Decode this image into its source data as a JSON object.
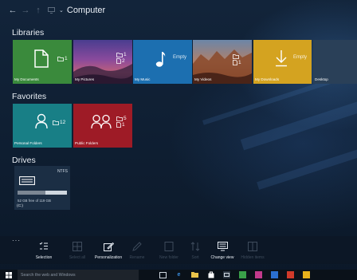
{
  "window": {
    "title": "Computer",
    "nav": {
      "back": "←",
      "forward": "→",
      "up": "↑"
    }
  },
  "sections": {
    "libraries": "Libraries",
    "favorites": "Favorites",
    "drives": "Drives"
  },
  "libraries": [
    {
      "name": "My Documents",
      "color": "#3a8a3c",
      "count": "1",
      "empty": ""
    },
    {
      "name": "My Pictures",
      "color": "#7a4aa0",
      "count": "2",
      "empty": ""
    },
    {
      "name": "My Music",
      "color": "#1c6fb0",
      "count": "",
      "empty": "Empty"
    },
    {
      "name": "My Videos",
      "color": "#a05a3a",
      "count": "1",
      "empty": ""
    },
    {
      "name": "My Downloads",
      "color": "#d4a320",
      "count": "",
      "empty": "Empty"
    },
    {
      "name": "Desktop",
      "color": "#2a4058",
      "count": "",
      "empty": ""
    }
  ],
  "favorites": [
    {
      "name": "Personal Folders",
      "color": "#187f86",
      "count": "12"
    },
    {
      "name": "Public Folders",
      "color": "#9e1b26",
      "count": "5"
    }
  ],
  "drive": {
    "filesystem": "NTFS",
    "free_text": "52 GB free of 119 GB",
    "used_fraction": 0.56,
    "letter": "(C:)"
  },
  "commands": {
    "more": "···",
    "items": [
      {
        "label": "Selection",
        "enabled": true,
        "icon": "selection-icon"
      },
      {
        "label": "Select all",
        "enabled": false,
        "icon": "select-all-icon"
      },
      {
        "label": "Personalization",
        "enabled": true,
        "icon": "personalization-icon"
      },
      {
        "label": "Rename",
        "enabled": false,
        "icon": "rename-icon"
      },
      {
        "label": "New folder",
        "enabled": false,
        "icon": "new-folder-icon"
      },
      {
        "label": "Sort",
        "enabled": false,
        "icon": "sort-icon"
      },
      {
        "label": "Change view",
        "enabled": true,
        "icon": "change-view-icon"
      },
      {
        "label": "Hidden items",
        "enabled": false,
        "icon": "hidden-items-icon"
      }
    ]
  },
  "taskbar": {
    "search_placeholder": "Search the web and Windows",
    "apps": [
      {
        "name": "task-view-icon",
        "color": "#cfd7df"
      },
      {
        "name": "edge-icon",
        "color": "#3b8fe0"
      },
      {
        "name": "file-explorer-icon",
        "color": "#e9c34a"
      },
      {
        "name": "store-icon",
        "color": "#ffffff"
      },
      {
        "name": "computer-app-icon",
        "color": "#cfd7df"
      },
      {
        "name": "green-app-icon",
        "color": "#3aa049"
      },
      {
        "name": "magenta-app-icon",
        "color": "#c23a8c"
      },
      {
        "name": "blue-app-icon",
        "color": "#2a6fd0"
      },
      {
        "name": "red-app-icon",
        "color": "#d03a2a"
      },
      {
        "name": "yellow-app-icon",
        "color": "#e8b21c"
      }
    ]
  }
}
